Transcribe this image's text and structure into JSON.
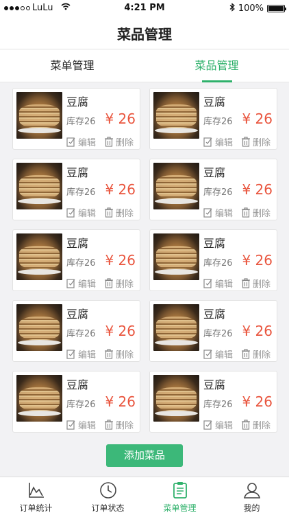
{
  "status_bar": {
    "carrier": "LuLu",
    "time": "4:21 PM",
    "battery": "100%"
  },
  "nav": {
    "title": "菜品管理"
  },
  "tabs": [
    {
      "label": "菜单管理",
      "active": false
    },
    {
      "label": "菜品管理",
      "active": true
    }
  ],
  "dishes": [
    {
      "name": "豆腐",
      "stock": "库存26",
      "price": "¥ 26",
      "edit": "编辑",
      "delete": "删除"
    },
    {
      "name": "豆腐",
      "stock": "库存26",
      "price": "¥ 26",
      "edit": "编辑",
      "delete": "删除"
    },
    {
      "name": "豆腐",
      "stock": "库存26",
      "price": "¥ 26",
      "edit": "编辑",
      "delete": "删除"
    },
    {
      "name": "豆腐",
      "stock": "库存26",
      "price": "¥ 26",
      "edit": "编辑",
      "delete": "删除"
    },
    {
      "name": "豆腐",
      "stock": "库存26",
      "price": "¥ 26",
      "edit": "编辑",
      "delete": "删除"
    },
    {
      "name": "豆腐",
      "stock": "库存26",
      "price": "¥ 26",
      "edit": "编辑",
      "delete": "删除"
    },
    {
      "name": "豆腐",
      "stock": "库存26",
      "price": "¥ 26",
      "edit": "编辑",
      "delete": "删除"
    },
    {
      "name": "豆腐",
      "stock": "库存26",
      "price": "¥ 26",
      "edit": "编辑",
      "delete": "删除"
    },
    {
      "name": "豆腐",
      "stock": "库存26",
      "price": "¥ 26",
      "edit": "编辑",
      "delete": "删除"
    },
    {
      "name": "豆腐",
      "stock": "库存26",
      "price": "¥ 26",
      "edit": "编辑",
      "delete": "删除"
    }
  ],
  "add_button": "添加菜品",
  "tabbar": [
    {
      "label": "订单统计",
      "icon": "chart-icon",
      "active": false
    },
    {
      "label": "订单状态",
      "icon": "clock-icon",
      "active": false
    },
    {
      "label": "菜单管理",
      "icon": "clipboard-icon",
      "active": true
    },
    {
      "label": "我的",
      "icon": "user-icon",
      "active": false
    }
  ],
  "colors": {
    "accent": "#2fb16b",
    "price": "#e9553e",
    "button": "#3cb879"
  }
}
